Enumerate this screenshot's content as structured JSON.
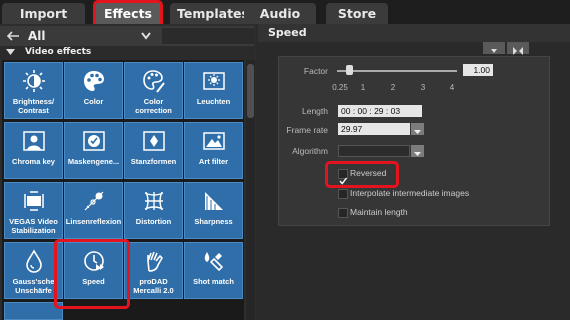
{
  "tabs": [
    {
      "label": "Import"
    },
    {
      "label": "Effects"
    },
    {
      "label": "Templates"
    },
    {
      "label": "Audio"
    },
    {
      "label": "Store"
    }
  ],
  "nav": {
    "back_icon": "arrow-left-icon",
    "filter_label": "All",
    "dropdown_icon": "chevron-down-icon"
  },
  "category": {
    "label": "Video effects"
  },
  "effects": [
    {
      "label": "Brightness/\nContrast",
      "icon": "brightness-icon"
    },
    {
      "label": "Color",
      "icon": "palette-icon"
    },
    {
      "label": "Color\ncorrection",
      "icon": "color-correction-icon"
    },
    {
      "label": "Leuchten",
      "icon": "glow-icon"
    },
    {
      "label": "Chroma key",
      "icon": "chroma-key-icon"
    },
    {
      "label": "Maskengene...",
      "icon": "mask-icon"
    },
    {
      "label": "Stanzformen",
      "icon": "stamp-icon"
    },
    {
      "label": "Art filter",
      "icon": "art-filter-icon"
    },
    {
      "label": "VEGAS Video\nStabilization",
      "icon": "stabilization-icon"
    },
    {
      "label": "Linsenreflexion",
      "icon": "lens-flare-icon"
    },
    {
      "label": "Distortion",
      "icon": "distortion-icon"
    },
    {
      "label": "Sharpness",
      "icon": "sharpness-icon"
    },
    {
      "label": "Gauss'sche\nUnschärfe",
      "icon": "blur-icon"
    },
    {
      "label": "Speed",
      "icon": "speed-icon"
    },
    {
      "label": "proDAD\nMercalli 2.0",
      "icon": "hand-icon"
    },
    {
      "label": "Shot match",
      "icon": "shot-match-icon"
    }
  ],
  "panel": {
    "title": "Speed",
    "factor_label": "Factor",
    "factor_value": "1.00",
    "factor_fraction": 0.05,
    "ticks": [
      "0.25",
      "1",
      "2",
      "3",
      "4"
    ],
    "length_label": "Length",
    "length_value": "00 : 00 : 29 : 03",
    "framerate_label": "Frame rate",
    "framerate_value": "29.97",
    "algorithm_label": "Algorithm",
    "algorithm_value": "",
    "checks": [
      {
        "label": "Reversed",
        "checked": true
      },
      {
        "label": "Interpolate intermediate images",
        "checked": false
      },
      {
        "label": "Maintain length",
        "checked": false
      }
    ]
  },
  "colors": {
    "highlight": "#e3141d",
    "tile": "#2f6ea8"
  }
}
